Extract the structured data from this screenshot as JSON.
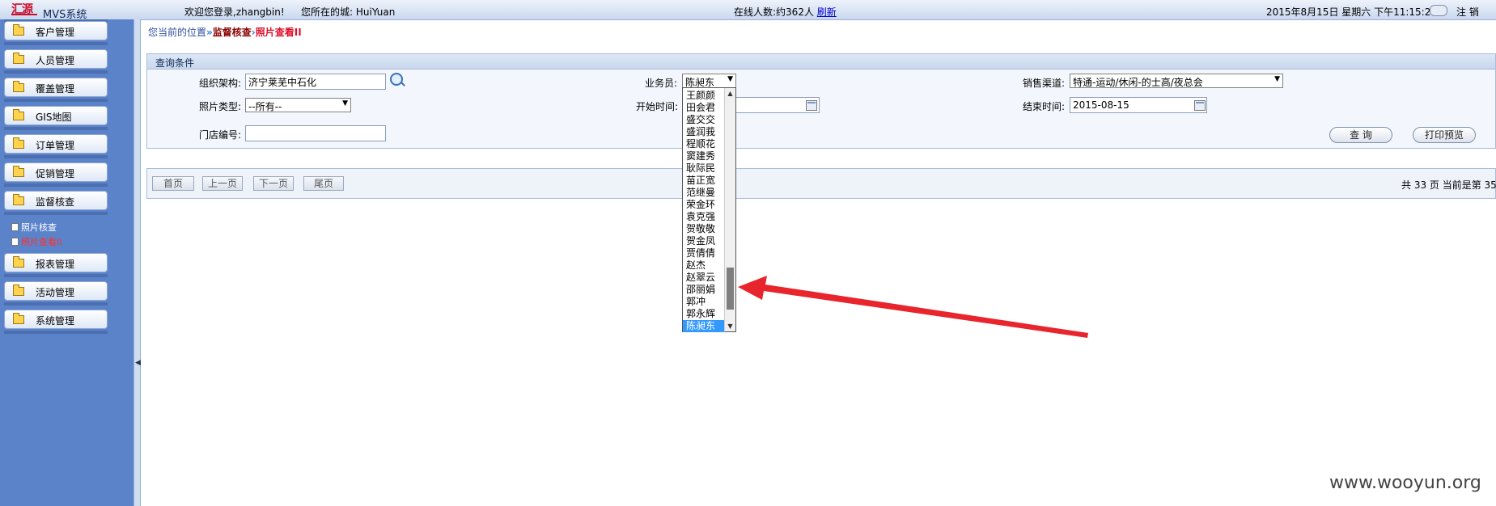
{
  "header": {
    "logo": "汇源",
    "system_title": "MVS系统",
    "welcome": "欢迎您登录,zhangbin!",
    "city": "您所在的城: HuiYuan",
    "online": "在线人数:约362人",
    "refresh": "刷新",
    "datetime": "2015年8月15日 星期六 下午11:15:21",
    "logout": "注 销"
  },
  "sidebar": {
    "menu": [
      {
        "label": "客户管理"
      },
      {
        "label": "人员管理"
      },
      {
        "label": "覆盖管理"
      },
      {
        "label": "GIS地图"
      },
      {
        "label": "订单管理"
      },
      {
        "label": "促销管理"
      },
      {
        "label": "监督核查"
      },
      {
        "label": "报表管理"
      },
      {
        "label": "活动管理"
      },
      {
        "label": "系统管理"
      }
    ],
    "sub_items": [
      {
        "label": "照片核查"
      },
      {
        "label": "照片查看II"
      }
    ]
  },
  "breadcrumb": {
    "prefix": "您当前的位置",
    "level1": "监督核查",
    "level2": "照片查看II"
  },
  "query": {
    "title": "查询条件",
    "org_label": "组织架构:",
    "org_value": "济宁莱芜中石化",
    "salesman_label": "业务员:",
    "salesman_value": "陈昶东",
    "channel_label": "销售渠道:",
    "channel_value": "特通-运动/休闲-的士高/夜总会",
    "photo_type_label": "照片类型:",
    "photo_type_value": "--所有--",
    "start_label": "开始时间:",
    "start_value": "",
    "end_label": "结束时间:",
    "end_value": "2015-08-15",
    "store_label": "门店编号:",
    "store_value": "",
    "query_btn": "查 询",
    "print_btn": "打印预览"
  },
  "pager": {
    "first": "首页",
    "prev": "上一页",
    "next": "下一页",
    "last": "尾页",
    "info": "共 33 页 当前是第 35"
  },
  "dropdown": {
    "items": [
      "王颜颜",
      "田会君",
      "盛交交",
      "盛润莪",
      "程顺花",
      "窦建秀",
      "耿际民",
      "苗正宽",
      "范继曼",
      "荣金环",
      "袁克强",
      "贺敬敬",
      "贺金凤",
      "贾倩倩",
      "赵杰",
      "赵翠云",
      "邵丽娟",
      "郭冲",
      "郭永辉",
      "陈昶东"
    ],
    "selected": "陈昶东"
  },
  "watermark": "www.wooyun.org"
}
